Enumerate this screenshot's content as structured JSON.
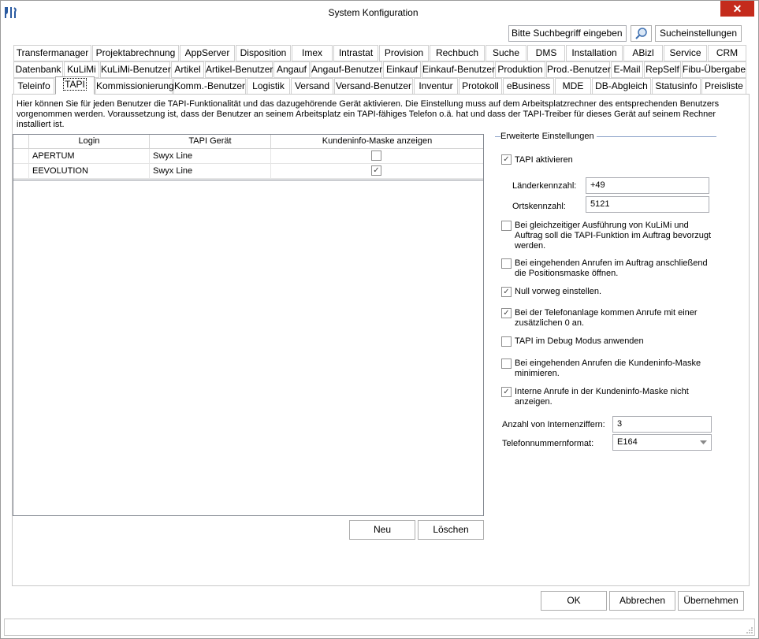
{
  "window": {
    "title": "System Konfiguration",
    "close_glyph": "✕"
  },
  "search": {
    "placeholder": "Bitte Suchbegriff eingeben",
    "settings_label": "Sucheinstellungen"
  },
  "tabs": {
    "row1": [
      "Transfermanager",
      "Projektabrechnung",
      "AppServer",
      "Disposition",
      "Imex",
      "Intrastat",
      "Provision",
      "Rechbuch",
      "Suche",
      "DMS",
      "Installation",
      "ABizl",
      "Service",
      "CRM"
    ],
    "row2": [
      "Datenbank",
      "KuLiMi",
      "KuLiMi-Benutzer",
      "Artikel",
      "Artikel-Benutzer",
      "Angauf",
      "Angauf-Benutzer",
      "Einkauf",
      "Einkauf-Benutzer",
      "Produktion",
      "Prod.-Benutzer",
      "E-Mail",
      "RepSelf",
      "Fibu-Übergabe"
    ],
    "row3": [
      "Teleinfo",
      "TAPI",
      "Kommissionierung",
      "Komm.-Benutzer",
      "Logistik",
      "Versand",
      "Versand-Benutzer",
      "Inventur",
      "Protokoll",
      "eBusiness",
      "MDE",
      "DB-Abgleich",
      "Statusinfo",
      "Preisliste"
    ],
    "active": "TAPI"
  },
  "description": "Hier können Sie für jeden Benutzer die TAPI-Funktionalität und das dazugehörende Gerät aktivieren. Die Einstellung muss auf dem Arbeitsplatzrechner des entsprechenden Benutzers vorgenommen werden. Voraussetzung ist, dass der Benutzer an seinem Arbeitsplatz ein TAPI-fähiges Telefon o.ä. hat und dass der TAPI-Treiber für dieses Gerät auf seinem Rechner installiert ist.",
  "grid": {
    "columns": [
      "Login",
      "TAPI Gerät",
      "Kundeninfo-Maske anzeigen"
    ],
    "rows": [
      {
        "login": "APERTUM",
        "device": "Swyx Line",
        "show_mask": false
      },
      {
        "login": "EEVOLUTION",
        "device": "Swyx Line",
        "show_mask": true
      }
    ]
  },
  "grid_buttons": {
    "new": "Neu",
    "delete": "Löschen"
  },
  "advanced": {
    "title": "Erweiterte Einstellungen",
    "tapi_active": {
      "label": "TAPI aktivieren",
      "checked": true
    },
    "country_code": {
      "label": "Länderkennzahl:",
      "value": "+49"
    },
    "area_code": {
      "label": "Ortskennzahl:",
      "value": "5121"
    },
    "options": [
      {
        "line1": "Bei gleichzeitiger Ausführung von KuLiMi und",
        "line2": "Auftrag soll die TAPI-Funktion im Auftrag bevorzugt",
        "line3": "werden.",
        "checked": false
      },
      {
        "line1": "Bei eingehenden Anrufen im Auftrag anschließend",
        "line2": "die Positionsmaske öffnen.",
        "line3": "",
        "checked": false
      },
      {
        "line1": "Null vorweg einstellen.",
        "line2": "",
        "line3": "",
        "checked": true
      },
      {
        "line1": "Bei der Telefonanlage kommen Anrufe mit einer",
        "line2": "zusätzlichen 0 an.",
        "line3": "",
        "checked": true
      },
      {
        "line1": "TAPI im Debug Modus anwenden",
        "line2": "",
        "line3": "",
        "checked": false
      },
      {
        "line1": "Bei eingehenden Anrufen die Kundeninfo-Maske",
        "line2": "minimieren.",
        "line3": "",
        "checked": false
      },
      {
        "line1": "Interne Anrufe in der Kundeninfo-Maske nicht",
        "line2": "anzeigen.",
        "line3": "",
        "checked": true
      }
    ],
    "internal_digits": {
      "label": "Anzahl von Internenziffern:",
      "value": "3"
    },
    "phone_format": {
      "label": "Telefonnummernformat:",
      "value": "E164"
    }
  },
  "footer": {
    "ok": "OK",
    "cancel": "Abbrechen",
    "apply": "Übernehmen"
  },
  "colors": {
    "close": "#c42b1c",
    "check": "#444444"
  }
}
